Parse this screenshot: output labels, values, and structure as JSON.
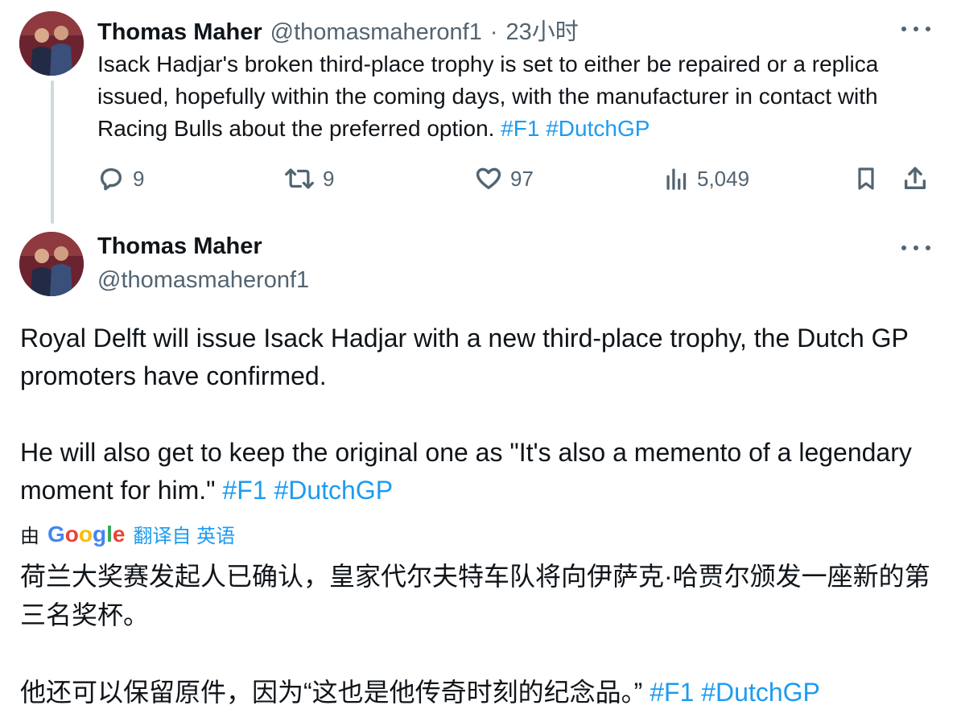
{
  "tweet1": {
    "author_name": "Thomas Maher",
    "handle": "@thomasmaheronf1",
    "separator": "·",
    "time": "23小时",
    "text": "Isack Hadjar's broken third-place trophy is set to either be repaired or a replica issued, hopefully within the coming days, with the manufacturer in contact with Racing Bulls about the preferred option.",
    "hashtags": [
      "#F1",
      "#DutchGP"
    ],
    "actions": {
      "reply_count": "9",
      "retweet_count": "9",
      "like_count": "97",
      "view_count": "5,049"
    }
  },
  "tweet2": {
    "author_name": "Thomas Maher",
    "handle": "@thomasmaheronf1",
    "paragraph1": "Royal Delft will issue Isack Hadjar with a new third-place trophy, the Dutch GP promoters have confirmed.",
    "paragraph2": "He will also get to keep the original one as \"It's also a memento of a legendary moment for him.\"",
    "hashtags": [
      "#F1",
      "#DutchGP"
    ],
    "translation": {
      "by": "由",
      "provider_letters": [
        "G",
        "o",
        "o",
        "g",
        "l",
        "e"
      ],
      "label": "翻译自 英语",
      "paragraph1": "荷兰大奖赛发起人已确认，皇家代尔夫特车队将向伊萨克·哈贾尔颁发一座新的第三名奖杯。",
      "paragraph2": "他还可以保留原件，因为“这也是他传奇时刻的纪念品。”",
      "hashtags": [
        "#F1",
        "#DutchGP"
      ]
    }
  },
  "colors": {
    "link": "#1d9bf0",
    "muted": "#536471",
    "text": "#0f1419",
    "thread_line": "#cfd9de",
    "google_blue": "#4285f4",
    "google_red": "#ea4335",
    "google_yellow": "#fbbc05",
    "google_green": "#34a853"
  },
  "icons": {
    "reply": "reply-icon",
    "retweet": "retweet-icon",
    "like": "heart-icon",
    "views": "views-icon",
    "bookmark": "bookmark-icon",
    "share": "share-icon",
    "more": "more-icon"
  }
}
